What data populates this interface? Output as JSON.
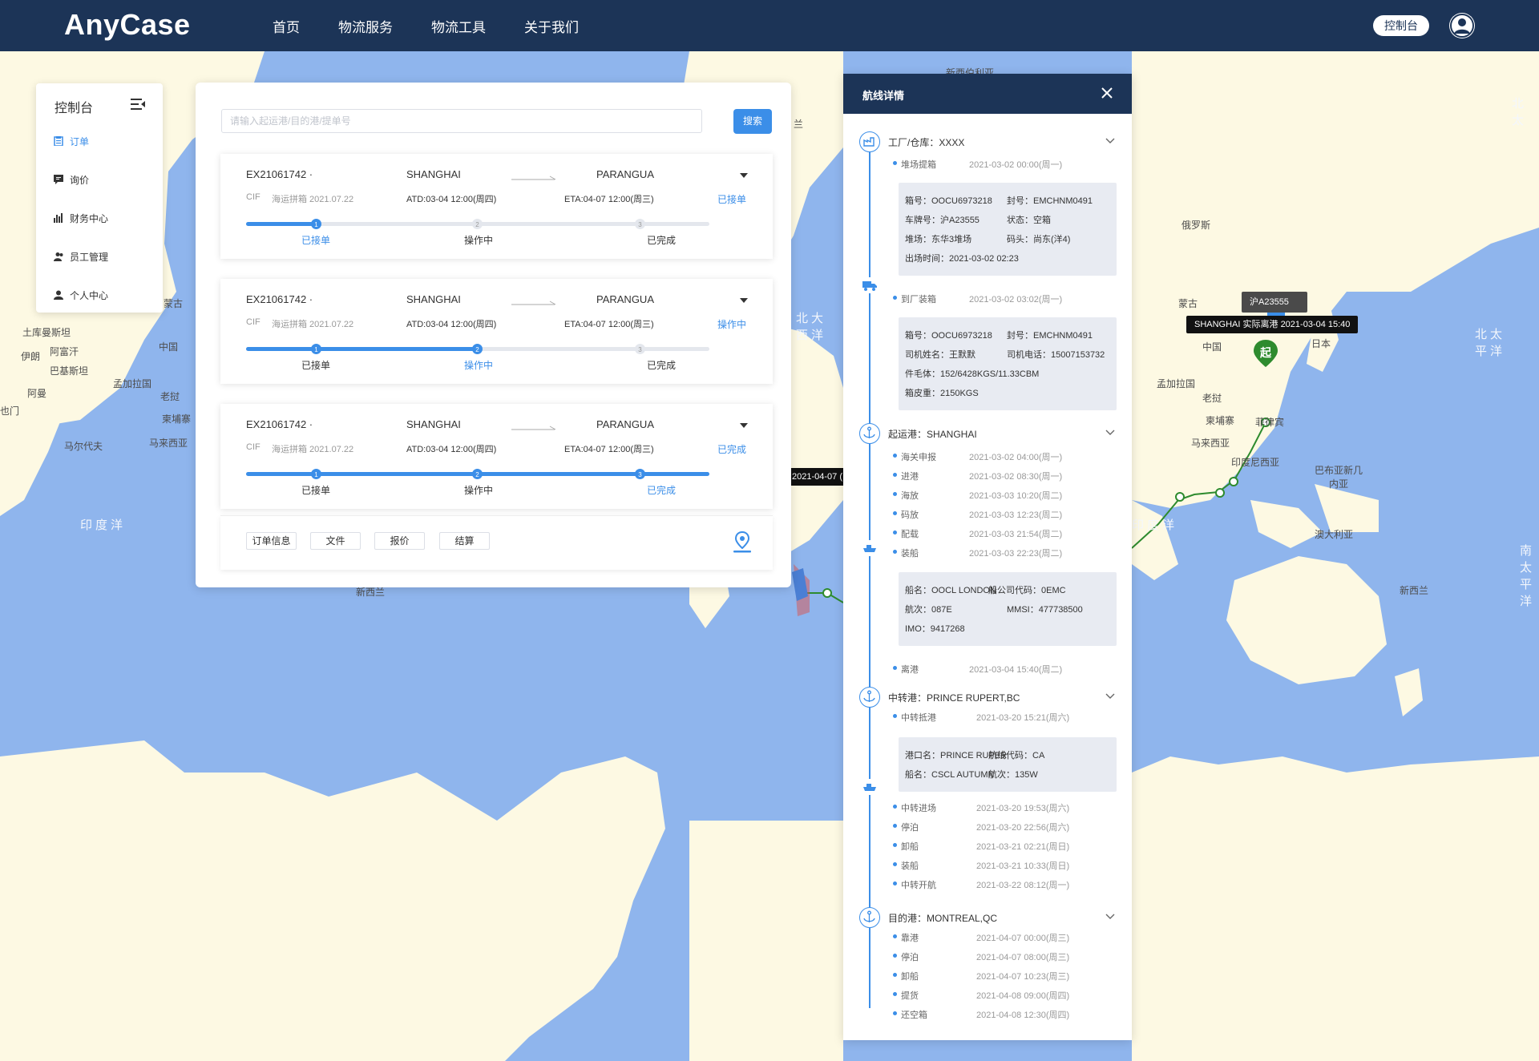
{
  "topbar": {
    "logo": "AnyCase",
    "nav": [
      "首页",
      "物流服务",
      "物流工具",
      "关于我们"
    ],
    "console_label": "控制台"
  },
  "map_labels": {
    "places": [
      "土库曼斯坦",
      "阿富汗",
      "伊朗",
      "巴基斯坦",
      "孟加拉国",
      "中国",
      "蒙古",
      "老挝",
      "柬埔寨",
      "马来西亚",
      "马尔代夫",
      "阿曼",
      "也门",
      "印度洋",
      "新西兰",
      "新西伯利亚",
      "俄罗斯",
      "蒙古",
      "中国",
      "日本",
      "孟加拉国",
      "老挝",
      "柬埔寨",
      "马来西亚",
      "菲律宾",
      "印度尼西亚",
      "巴布亚新几内亚",
      "澳大利亚",
      "新西兰",
      "兰"
    ],
    "oceans": [
      "北大西洋",
      "北太平洋",
      "印度洋",
      "南太平洋",
      "北太"
    ]
  },
  "sidebar": {
    "title": "控制台",
    "items": [
      {
        "label": "订单",
        "icon": "clipboard-icon",
        "active": true
      },
      {
        "label": "询价",
        "icon": "chat-icon",
        "active": false
      },
      {
        "label": "财务中心",
        "icon": "chart-icon",
        "active": false
      },
      {
        "label": "员工管理",
        "icon": "users-icon",
        "active": false
      },
      {
        "label": "个人中心",
        "icon": "user-icon",
        "active": false
      }
    ]
  },
  "search": {
    "placeholder": "请输入起运港/目的港/提单号",
    "button": "搜索"
  },
  "orders": [
    {
      "no": "EX21061742 ·",
      "from": "SHANGHAI",
      "to": "PARANGUA",
      "term": "CIF",
      "type": "海运拼箱 2021.07.22",
      "atd": "ATD:03-04 12:00(周四)",
      "eta": "ETA:04-07 12:00(周三)",
      "status": "已接单",
      "progress": 0.15,
      "step": 1
    },
    {
      "no": "EX21061742 ·",
      "from": "SHANGHAI",
      "to": "PARANGUA",
      "term": "CIF",
      "type": "海运拼箱 2021.07.22",
      "atd": "ATD:03-04 12:00(周四)",
      "eta": "ETA:04-07 12:00(周三)",
      "status": "操作中",
      "progress": 0.5,
      "step": 2
    },
    {
      "no": "EX21061742 ·",
      "from": "SHANGHAI",
      "to": "PARANGUA",
      "term": "CIF",
      "type": "海运拼箱 2021.07.22",
      "atd": "ATD:03-04 12:00(周四)",
      "eta": "ETA:04-07 12:00(周三)",
      "status": "已完成",
      "progress": 1.0,
      "step": 3
    }
  ],
  "steps": [
    "已接单",
    "操作中",
    "已完成"
  ],
  "step_numbers": [
    "1",
    "2",
    "3"
  ],
  "order_actions": [
    "订单信息",
    "文件",
    "报价",
    "结算"
  ],
  "detail": {
    "title": "航线详情",
    "factory": {
      "title": "工厂/仓库：XXXX",
      "events": [
        {
          "name": "堆场提箱",
          "time": "2021-03-02 00:00(周一)"
        }
      ],
      "info": [
        [
          "箱号：OOCU6973218",
          "封号：EMCHNM0491"
        ],
        [
          "车牌号：沪A23555",
          "状态：空箱"
        ],
        [
          "堆场：东华3堆场",
          "码头：尚东(洋4)"
        ],
        [
          "出场时间：2021-03-02 02:23"
        ]
      ]
    },
    "loading": {
      "events": [
        {
          "name": "到厂装箱",
          "time": "2021-03-02 03:02(周一)"
        }
      ],
      "info": [
        [
          "箱号：OOCU6973218",
          "封号：EMCHNM0491"
        ],
        [
          "司机姓名：王默默",
          "司机电话：15007153732"
        ],
        [
          "件毛体：152/6428KGS/11.33CBM"
        ],
        [
          "箱皮重：2150KGS"
        ]
      ]
    },
    "origin": {
      "title": "起运港：SHANGHAI",
      "events": [
        {
          "name": "海关申报",
          "time": "2021-03-02 04:00(周一)"
        },
        {
          "name": "进港",
          "time": "2021-03-02 08:30(周一)"
        },
        {
          "name": "海放",
          "time": "2021-03-03 10:20(周二)"
        },
        {
          "name": "码放",
          "time": "2021-03-03 12:23(周二)"
        },
        {
          "name": "配载",
          "time": "2021-03-03 21:54(周二)"
        },
        {
          "name": "装船",
          "time": "2021-03-03 22:23(周二)"
        }
      ],
      "info": [
        [
          "船名：OOCL LONDON",
          "船公司代码：0EMC"
        ],
        [
          "航次：087E",
          "MMSI：477738500"
        ],
        [
          "IMO：9417268"
        ]
      ],
      "after": [
        {
          "name": "离港",
          "time": "2021-03-04 15:40(周二)"
        }
      ]
    },
    "transit": {
      "title": "中转港：PRINCE RUPERT,BC",
      "events": [
        {
          "name": "中转抵港",
          "time": "2021-03-20 15:21(周六)"
        }
      ],
      "info": [
        [
          "港口名：PRINCE RUPER",
          "航线代码：CA"
        ],
        [
          "船名：CSCL AUTUMN",
          "航次：135W"
        ]
      ],
      "after": [
        {
          "name": "中转进场",
          "time": "2021-03-20 19:53(周六)"
        },
        {
          "name": "停泊",
          "time": "2021-03-20 22:56(周六)"
        },
        {
          "name": "卸船",
          "time": "2021-03-21 02:21(周日)"
        },
        {
          "name": "装船",
          "time": "2021-03-21 10:33(周日)"
        },
        {
          "name": "中转开航",
          "time": "2021-03-22 08:12(周一)"
        }
      ]
    },
    "dest": {
      "title": "目的港：MONTREAL,QC",
      "events": [
        {
          "name": "靠港",
          "time": "2021-04-07 00:00(周三)"
        },
        {
          "name": "停泊",
          "time": "2021-04-07 08:00(周三)"
        },
        {
          "name": "卸船",
          "time": "2021-04-07 10:23(周三)"
        },
        {
          "name": "提货",
          "time": "2021-04-08 09:00(周四)"
        },
        {
          "name": "还空箱",
          "time": "2021-04-08 12:30(周四)"
        }
      ]
    }
  },
  "map_overlay": {
    "plate_tip": "沪A23555",
    "depart_tip": "SHANGHAI  实际离港  2021-03-04 15:40",
    "start_marker": "起",
    "arrival_tip": "2021-04-07 (",
    "route_color": "#2e8b2e"
  },
  "colors": {
    "primary": "#3b8ee8",
    "nav": "#1c3457",
    "ocean": "#8fb5ed",
    "land": "#fdf9e3"
  }
}
